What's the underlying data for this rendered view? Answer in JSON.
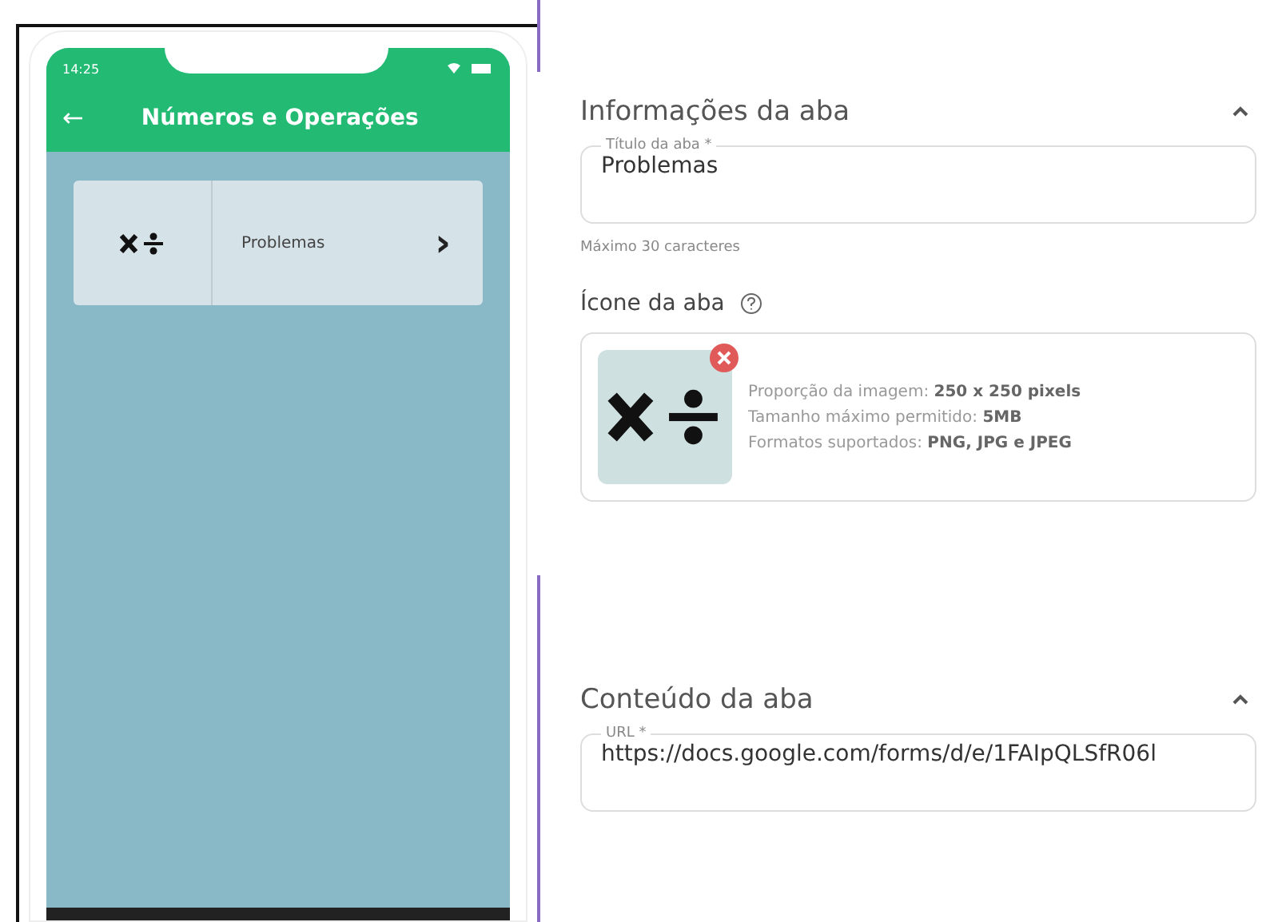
{
  "phone": {
    "time": "14:25",
    "title": "Números e Operações",
    "back": "←",
    "items": [
      {
        "label": "Problemas",
        "chevron": "›"
      }
    ]
  },
  "sections": [
    {
      "title": "Informações da aba",
      "expanded": true,
      "field": {
        "label": "Título da aba *",
        "value": "Problemas"
      },
      "hint": "Máximo 30 caracteres",
      "icon_label": "Ícone da aba",
      "upload": {
        "lines": [
          "Proporção da imagem: **250 x 250 pixels**",
          "Tamanho máximo permitido: **5MB**",
          "Formatos suportados: **PNG, JPG e JPEG**"
        ]
      }
    },
    {
      "title": "Conteúdo da aba",
      "expanded": true,
      "field": {
        "label": "URL *",
        "value": "https://docs.google.com/forms/d/e/1FAIpQLSfR06l"
      }
    }
  ]
}
